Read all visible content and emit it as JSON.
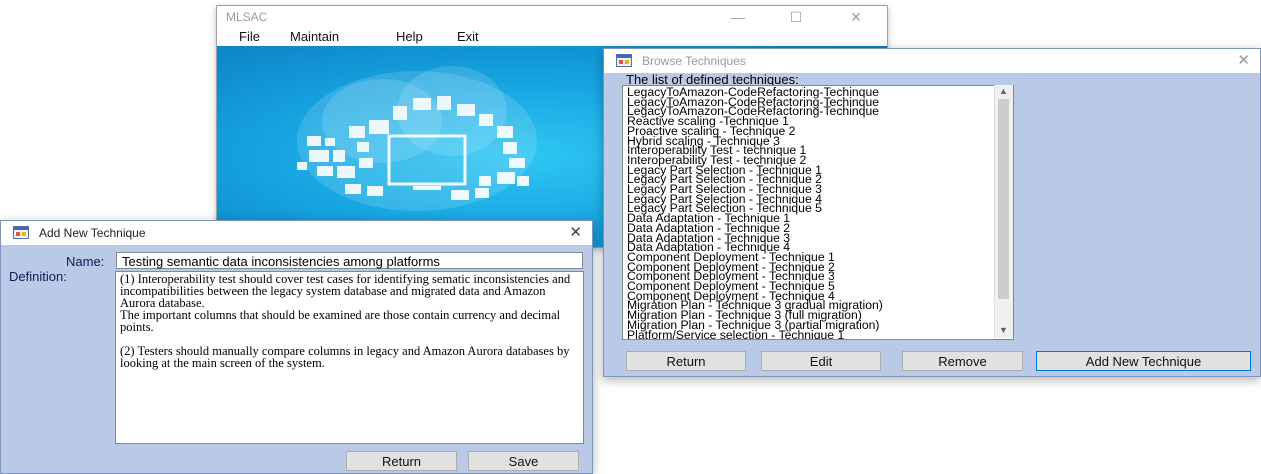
{
  "main_window": {
    "title": "MLSAC",
    "menu": [
      "File",
      "Maintain",
      "Help",
      "Exit"
    ]
  },
  "browse_dialog": {
    "title": "Browse Techniques",
    "list_label": "The list of defined techniques:",
    "items": [
      "LegacyToAmazon-CodeRefactoring-Techinque",
      "LegacyToAmazon-CodeRefactoring-Techinque",
      "LegacyToAmazon-CodeRefactoring-Techinque",
      "Reactive scaling -Technique 1",
      "Proactive scaling - Technique 2",
      "Hybrid scaling - Technique 3",
      "Interoperability Test - technique 1",
      "Interoperability Test - technique 2",
      "Legacy Part Selection - Technique 1",
      "Legacy Part Selection - Technique 2",
      "Legacy Part Selection - Technique 3",
      "Legacy Part Selection - Technique 4",
      "Legacy Part Selection - Technique 5",
      "Data Adaptation - Technique 1",
      "Data Adaptation - Technique 2",
      "Data Adaptation - Technique 3",
      "Data Adaptation - Technique 4",
      "Component Deployment - Technique 1",
      "Component Deployment - Technique 2",
      "Component Deployment - Technique 3",
      "Component Deployment - Technique 5",
      "Component Deployment - Technique 4",
      "Migration Plan - Technique 3 gradual migration)",
      "Migration Plan - Technique 3 (full migration)",
      "Migration Plan - Technique 3 (partial migration)",
      "Platform/Service selection - Technique 1"
    ],
    "buttons": {
      "return": "Return",
      "edit": "Edit",
      "remove": "Remove",
      "add_new": "Add New Technique"
    }
  },
  "add_dialog": {
    "title": "Add New Technique",
    "name_label": "Name:",
    "definition_label": "Definition:",
    "name_value": "Testing semantic data inconsistencies among platforms",
    "definition_value": "(1) Interoperability test should cover test cases for identifying sematic inconsistencies and incompatibilities between the legacy system database and migrated data and Amazon Aurora database.\nThe important columns that should be examined are those contain currency and decimal points.\n\n(2) Testers should manually compare columns in legacy and Amazon Aurora databases by looking at the main screen of the system.",
    "buttons": {
      "return": "Return",
      "save": "Save"
    }
  },
  "colors": {
    "dialog_background": "#b9c9e6",
    "canvas_blue": "#17a6e2",
    "label_text": "#0a1e57"
  },
  "icons": {
    "dialog_icon": "app-window-icon",
    "close": "close-icon"
  }
}
